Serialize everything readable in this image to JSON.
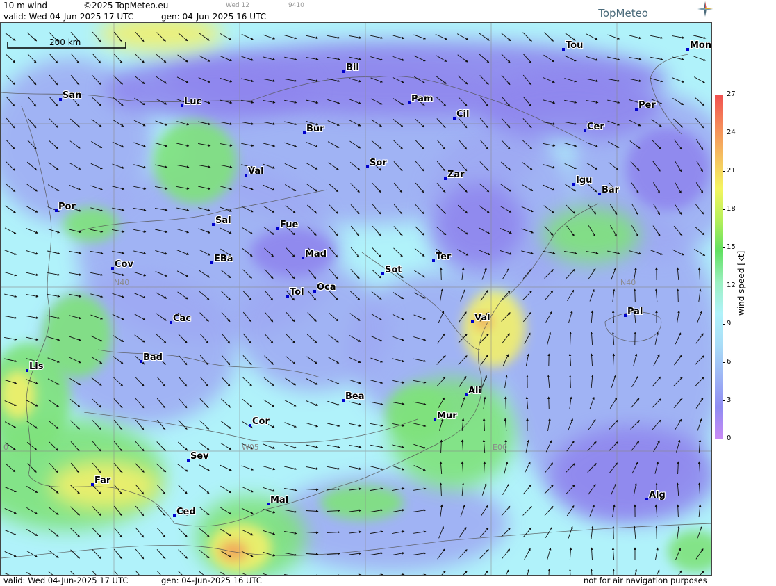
{
  "header": {
    "product": "10 m wind",
    "copyright": "©2025 TopMeteo.eu",
    "run_hint": "Wed 12",
    "run_code": "9410",
    "valid": "valid:  Wed  04-Jun-2025  17 UTC",
    "gen": "gen: 04-Jun-2025 16 UTC",
    "logo": "TopMeteo"
  },
  "footer": {
    "valid": "valid:  Wed  04-Jun-2025  17 UTC",
    "gen": "gen: 04-Jun-2025 16 UTC",
    "disclaimer": "not for air navigation purposes"
  },
  "scale_bar": "200 km",
  "grid_labels": [
    "N40",
    "N40",
    "W05",
    "E00",
    "0"
  ],
  "colorbar": {
    "label": "wind speed  [kt]",
    "ticks": [
      "0",
      "3",
      "6",
      "9",
      "12",
      "15",
      "18",
      "21",
      "24",
      "27"
    ],
    "colors": [
      "#c98af5",
      "#8f8cf2",
      "#9eb6f5",
      "#a9ddf7",
      "#b0f2fa",
      "#9cf0c2",
      "#60e060",
      "#b6ef5a",
      "#f5f560",
      "#f5c060",
      "#f58a5a",
      "#f05050"
    ]
  },
  "colors": {
    "ocean": "#b0f2fa",
    "calm": "#9ea9f3",
    "violet": "#8f86ee",
    "green": "#7fe27c",
    "yellow": "#f3f06a",
    "orange": "#f2a35a",
    "city": "#0000cc"
  },
  "cities": [
    {
      "name": "San"
    },
    {
      "name": "Luc"
    },
    {
      "name": "Bil"
    },
    {
      "name": "Pam"
    },
    {
      "name": "Tou"
    },
    {
      "name": "Mon"
    },
    {
      "name": "Per"
    },
    {
      "name": "Cer"
    },
    {
      "name": "Cil"
    },
    {
      "name": "Bur"
    },
    {
      "name": "Sor"
    },
    {
      "name": "Zar"
    },
    {
      "name": "Igu"
    },
    {
      "name": "Bar"
    },
    {
      "name": "Val"
    },
    {
      "name": "Por"
    },
    {
      "name": "Sal"
    },
    {
      "name": "Fue"
    },
    {
      "name": "Mad"
    },
    {
      "name": "Ter"
    },
    {
      "name": "Cov"
    },
    {
      "name": "EBa"
    },
    {
      "name": "Sot"
    },
    {
      "name": "Tol"
    },
    {
      "name": "Oca"
    },
    {
      "name": "Val"
    },
    {
      "name": "Pal"
    },
    {
      "name": "Cac"
    },
    {
      "name": "Bad"
    },
    {
      "name": "Lis"
    },
    {
      "name": "Ali"
    },
    {
      "name": "Bea"
    },
    {
      "name": "Mur"
    },
    {
      "name": "Cor"
    },
    {
      "name": "Sev"
    },
    {
      "name": "Far"
    },
    {
      "name": "Alg"
    },
    {
      "name": "Mal"
    },
    {
      "name": "Ced"
    }
  ]
}
